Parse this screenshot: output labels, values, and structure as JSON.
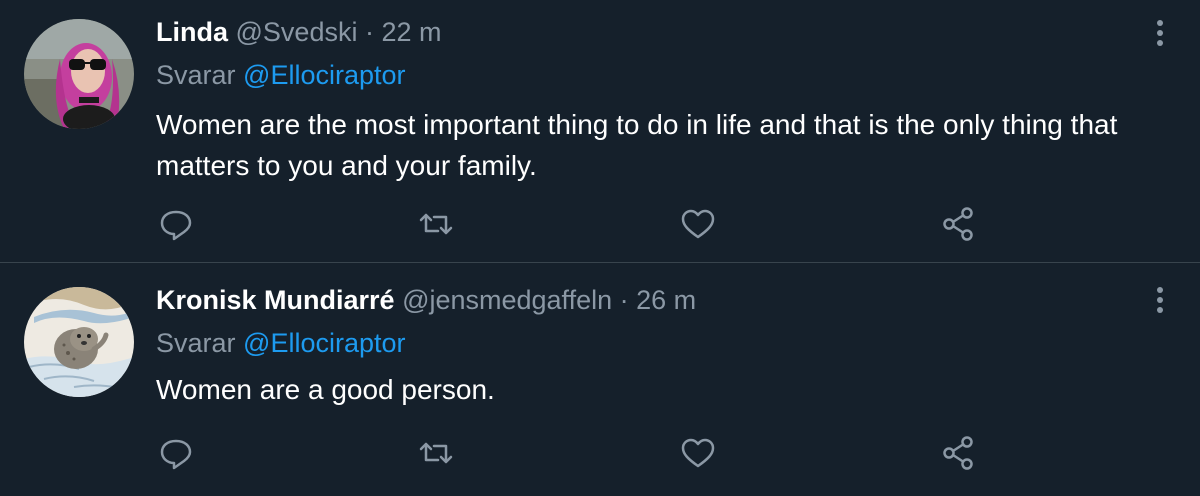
{
  "tweets": [
    {
      "author_name": "Linda",
      "handle": "@Svedski",
      "separator": "·",
      "time": "22 m",
      "reply_prefix": "Svarar",
      "reply_to": "@Ellociraptor",
      "text": "Women are the most important thing to do in life and that is the only thing that matters to you and your family.",
      "avatar_icon": "avatar-woman-purple-hair-sunglasses"
    },
    {
      "author_name": "Kronisk Mundiarré",
      "handle": "@jensmedgaffeln",
      "separator": "·",
      "time": "26 m",
      "reply_prefix": "Svarar",
      "reply_to": "@Ellociraptor",
      "text": "Women are a good person.",
      "avatar_icon": "avatar-seal-drawing"
    }
  ],
  "icons": {
    "reply": "comment-icon",
    "retweet": "retweet-icon",
    "like": "heart-icon",
    "share": "share-icon",
    "more": "more-vertical-icon"
  },
  "colors": {
    "background": "#15202b",
    "text": "#ffffff",
    "secondary": "#8b98a5",
    "link": "#1d9bf0",
    "divider": "#38444d"
  }
}
